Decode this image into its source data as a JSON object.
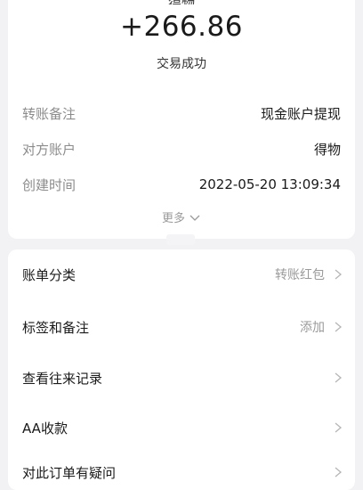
{
  "summary": {
    "name_partial": "得物",
    "amount": "+266.86",
    "status": "交易成功"
  },
  "details": [
    {
      "label": "转账备注",
      "value": "现金账户提现"
    },
    {
      "label": "对方账户",
      "value": "得物"
    },
    {
      "label": "创建时间",
      "value": "2022-05-20 13:09:34"
    }
  ],
  "more_label": "更多",
  "menu": [
    {
      "title": "账单分类",
      "hint": "转账红包"
    },
    {
      "title": "标签和备注",
      "hint": "添加"
    },
    {
      "title": "查看往来记录",
      "hint": ""
    },
    {
      "title": "AA收款",
      "hint": ""
    },
    {
      "title": "对此订单有疑问",
      "hint": ""
    }
  ],
  "icons": {
    "more": "chevron-down-icon",
    "row": "chevron-right-icon"
  },
  "colors": {
    "background": "#f2f2f4",
    "card": "#ffffff",
    "label_gray": "#8c8c8c",
    "hint_gray": "#9a9a9a"
  }
}
